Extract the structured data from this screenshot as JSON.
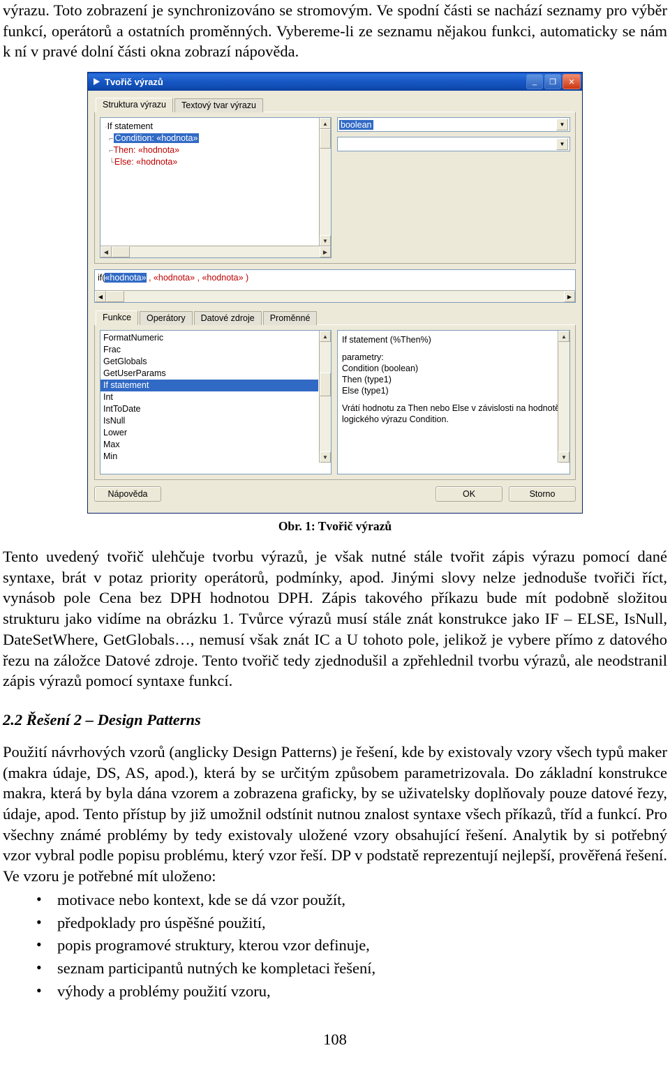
{
  "document": {
    "paragraph_1": "výrazu. Toto zobrazení je synchronizováno se stromovým. Ve spodní části se nachází seznamy pro výběr funkcí, operátorů a ostatních proměnných. Vybereme-li ze seznamu nějakou funkci, automaticky se nám k ní v pravé dolní části okna zobrazí nápověda.",
    "figure_caption": "Obr. 1: Tvořič výrazů",
    "paragraph_2": "Tento uvedený tvořič ulehčuje tvorbu výrazů, je však nutné stále tvořit zápis výrazu pomocí dané syntaxe, brát v potaz priority operátorů, podmínky, apod. Jinými slovy nelze jednoduše tvořiči říct, vynásob pole Cena bez DPH hodnotou DPH. Zápis takového příkazu bude mít podobně složitou strukturu jako vidíme na obrázku 1. Tvůrce výrazů musí stále znát konstrukce jako IF – ELSE, IsNull, DateSetWhere, GetGlobals…, nemusí však znát IC a U tohoto pole, jelikož je vybere přímo z datového řezu na záložce Datové zdroje. Tento tvořič tedy zjednodušil a zpřehlednil tvorbu výrazů, ale neodstranil zápis výrazů pomocí syntaxe funkcí.",
    "section_heading": "2.2 Řešení 2 – Design Patterns",
    "paragraph_3": "Použití návrhových vzorů (anglicky Design Patterns) je řešení, kde by existovaly vzory všech typů maker (makra údaje, DS, AS, apod.), která by se určitým způsobem parametrizovala. Do základní konstrukce makra, která by byla dána vzorem a zobrazena graficky, by se uživatelsky doplňovaly pouze datové řezy, údaje, apod. Tento přístup by již umožnil odstínit nutnou znalost syntaxe všech příkazů, tříd a funkcí. Pro všechny známé problémy by tedy existovaly uložené vzory obsahující řešení. Analytik by si potřebný vzor vybral podle popisu problému, který vzor řeší. DP v podstatě reprezentují nejlepší, prověřená řešení. Ve vzoru je potřebné mít uloženo:",
    "bullets": [
      "motivace nebo kontext, kde se dá vzor použít,",
      "předpoklady pro úspěšné použití,",
      "popis programové struktury, kterou vzor definuje,",
      "seznam participantů nutných ke kompletaci řešení,",
      "výhody a problémy použití vzoru,"
    ],
    "page_number": "108"
  },
  "screenshot": {
    "window": {
      "title": "Tvořič výrazů",
      "icon": "play-triangle-icon",
      "minimize_label": "_",
      "maximize_label": "❐",
      "close_label": "✕"
    },
    "top_tabs": [
      {
        "label": "Struktura výrazu",
        "active": true
      },
      {
        "label": "Textový tvar výrazu",
        "active": false
      }
    ],
    "tree": {
      "nodes": [
        {
          "text": "If statement",
          "style": "root"
        },
        {
          "text": "Condition: «hodnota»",
          "style": "selected"
        },
        {
          "text": "Then: «hodnota»",
          "style": "red"
        },
        {
          "text": "Else: «hodnota»",
          "style": "red"
        }
      ]
    },
    "combo_type": {
      "value": "boolean",
      "arrow": "▼"
    },
    "combo_value": {
      "value": "",
      "arrow": "▼"
    },
    "expression": {
      "prefix": "if(",
      "highlight": "«hodnota»",
      "suffix": " , «hodnota» , «hodnota» )"
    },
    "bottom_tabs": [
      {
        "label": "Funkce",
        "active": true
      },
      {
        "label": "Operátory",
        "active": false
      },
      {
        "label": "Datové zdroje",
        "active": false
      },
      {
        "label": "Proměnné",
        "active": false
      }
    ],
    "function_list": {
      "items": [
        {
          "label": "FormatNumeric",
          "selected": false
        },
        {
          "label": "Frac",
          "selected": false
        },
        {
          "label": "GetGlobals",
          "selected": false
        },
        {
          "label": "GetUserParams",
          "selected": false
        },
        {
          "label": "If statement",
          "selected": true
        },
        {
          "label": "Int",
          "selected": false
        },
        {
          "label": "IntToDate",
          "selected": false
        },
        {
          "label": "IsNull",
          "selected": false
        },
        {
          "label": "Lower",
          "selected": false
        },
        {
          "label": "Max",
          "selected": false
        },
        {
          "label": "Min",
          "selected": false
        }
      ]
    },
    "help": {
      "title": "If statement (%Then%)",
      "params_label": "parametry:",
      "params": [
        "Condition (boolean)",
        "Then (type1)",
        "Else (type1)"
      ],
      "description": "Vrátí hodnotu za Then nebo Else v závislosti na hodnotě logického výrazu Condition."
    },
    "buttons": {
      "help": "Nápověda",
      "ok": "OK",
      "cancel": "Storno"
    }
  }
}
